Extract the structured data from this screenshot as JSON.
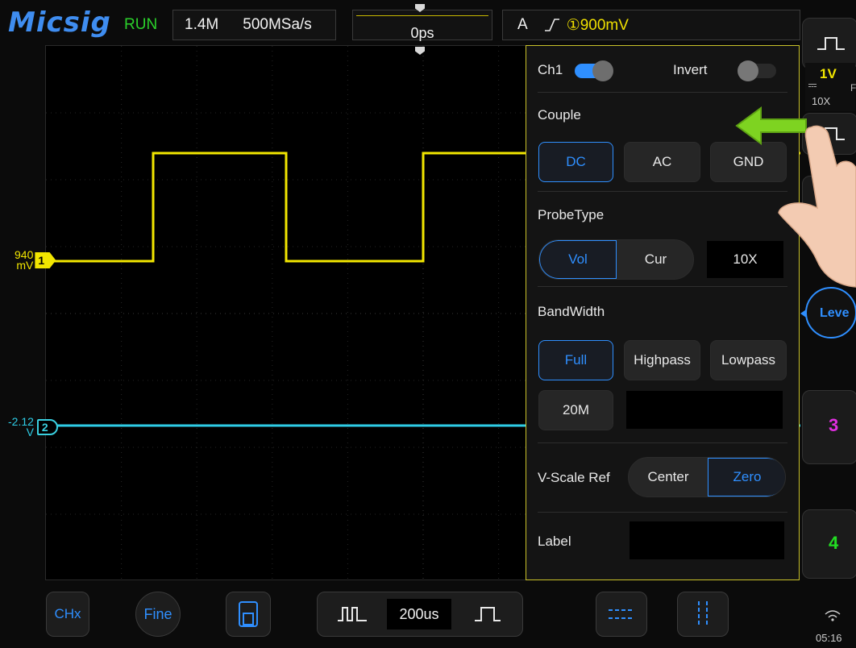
{
  "header": {
    "brand": "Micsig",
    "run_state": "RUN",
    "memory_depth": "1.4M",
    "sample_rate": "500MSa/s",
    "time_offset": "0ps",
    "trigger_source": "A",
    "trigger_level": "①900mV"
  },
  "channels": {
    "ch1": {
      "number": "1",
      "offset_label": "940\nmV",
      "color": "#f2e600"
    },
    "ch2": {
      "number": "2",
      "offset_label": "-2.12\nV",
      "color": "#2ecde6"
    }
  },
  "panel": {
    "channel_label": "Ch1",
    "channel_enabled": true,
    "invert_label": "Invert",
    "invert_enabled": false,
    "couple": {
      "title": "Couple",
      "options": [
        "DC",
        "AC",
        "GND"
      ],
      "selected": "DC"
    },
    "probe": {
      "title": "ProbeType",
      "options": [
        "Vol",
        "Cur"
      ],
      "selected": "Vol",
      "ratio": "10X"
    },
    "bandwidth": {
      "title": "BandWidth",
      "options": [
        "Full",
        "Highpass",
        "Lowpass"
      ],
      "selected": "Full",
      "limit": "20M"
    },
    "vscale": {
      "title": "V-Scale Ref",
      "options": [
        "Center",
        "Zero"
      ],
      "selected": "Zero"
    },
    "label": {
      "title": "Label",
      "value": ""
    }
  },
  "right_strip": {
    "ch1_scale": "1V",
    "ch1_probe": "10X",
    "ch1_coupling_letter": "F",
    "level_label": "Leve",
    "ch3_label": "3",
    "ch4_label": "4",
    "ch3_color": "#e02ee0",
    "ch4_color": "#22dd22"
  },
  "bottom": {
    "chx_label": "CHx",
    "fine_label": "Fine",
    "timebase": "200us",
    "clock": "05:16"
  },
  "accent_color": "#2f8fff"
}
